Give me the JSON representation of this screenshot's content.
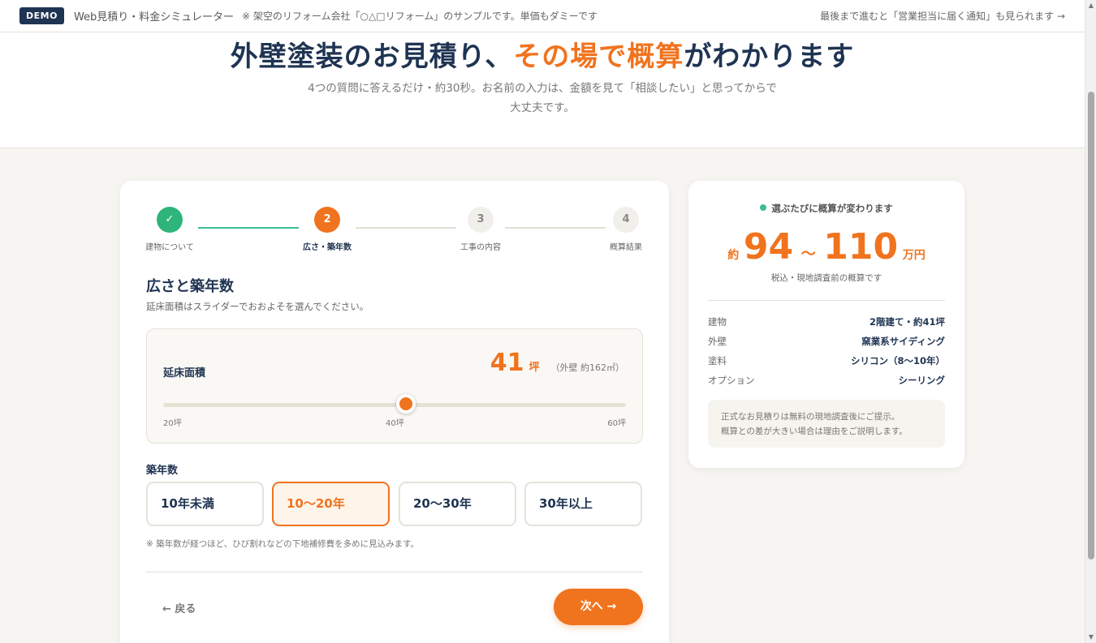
{
  "topbar": {
    "badge": "DEMO",
    "title": "Web見積り・料金シミュレーター",
    "note": "※ 架空のリフォーム会社「○△□リフォーム」のサンプルです。単価もダミーです",
    "right_link": "最後まで進むと「営業担当に届く通知」も見られます →"
  },
  "hero": {
    "title_part1": "外壁塗装のお見積り、",
    "title_accent": "その場で概算",
    "title_part2": "がわかります",
    "subtitle": "4つの質問に答えるだけ・約30秒。お名前の入力は、金額を見て「相談したい」と思ってからで大丈夫です。"
  },
  "steps": [
    {
      "number": "✓",
      "label": "建物について",
      "state": "done"
    },
    {
      "number": "2",
      "label": "広さ・築年数",
      "state": "active"
    },
    {
      "number": "3",
      "label": "工事の内容",
      "state": "todo"
    },
    {
      "number": "4",
      "label": "概算結果",
      "state": "todo"
    }
  ],
  "form": {
    "title": "広さと築年数",
    "description": "延床面積はスライダーでおおよそを選んでください。",
    "slider": {
      "label": "延床面積",
      "value": "41",
      "unit": "坪",
      "sub": "（外壁 約162㎡）",
      "min_label": "20坪",
      "mid_label": "40坪",
      "max_label": "60坪",
      "min": 20,
      "max": 60,
      "current": 41
    },
    "age_label": "築年数",
    "age_options": [
      "10年未満",
      "10〜20年",
      "20〜30年",
      "30年以上"
    ],
    "age_selected": "10〜20年",
    "age_note": "※ 築年数が経つほど、ひび割れなどの下地補修費を多めに見込みます。",
    "back_label": "← 戻る",
    "next_label": "次へ →"
  },
  "estimate": {
    "live_label": "選ぶたびに概算が変わります",
    "prefix": "約",
    "low": "94",
    "tilde": "〜",
    "high": "110",
    "unit": "万円",
    "note": "税込・現地調査前の概算です",
    "rows": [
      {
        "key": "建物",
        "value": "2階建て・約41坪"
      },
      {
        "key": "外壁",
        "value": "窯業系サイディング"
      },
      {
        "key": "塗料",
        "value": "シリコン（8〜10年）"
      },
      {
        "key": "オプション",
        "value": "シーリング"
      }
    ],
    "disclaimer_line1": "正式なお見積りは無料の現地調査後にご提示。",
    "disclaimer_line2": "概算との差が大きい場合は理由をご説明します。"
  },
  "colors": {
    "accent": "#f0731e",
    "navy": "#1f3452",
    "success": "#2fb47c"
  }
}
